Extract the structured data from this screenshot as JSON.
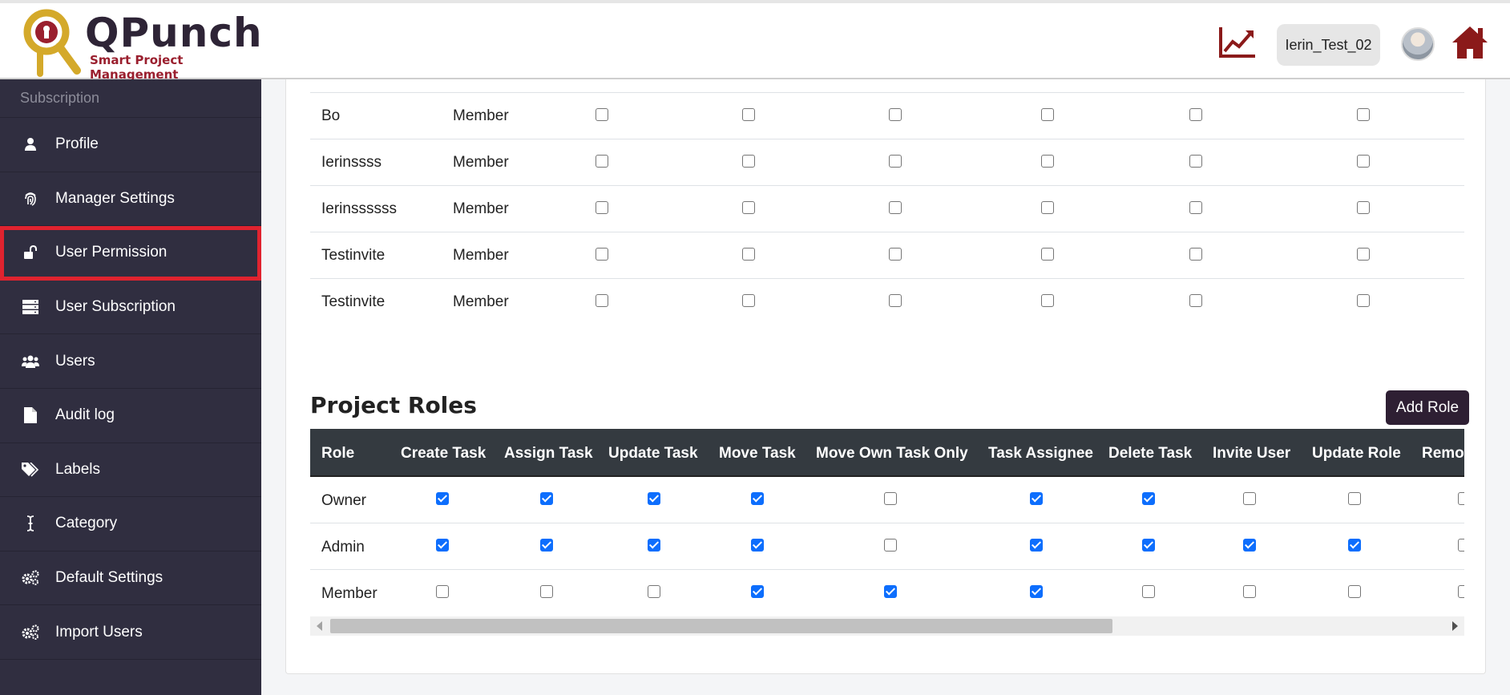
{
  "header": {
    "logo_title": "QPunch",
    "logo_subtitle": "Smart Project Management",
    "user_name": "Ierin_Test_02"
  },
  "sidebar": {
    "heading": "Subscription",
    "items": [
      {
        "label": "Profile",
        "icon": "user-icon"
      },
      {
        "label": "Manager Settings",
        "icon": "fingerprint-icon"
      },
      {
        "label": "User Permission",
        "icon": "unlock-icon",
        "active": true
      },
      {
        "label": "User Subscription",
        "icon": "server-icon"
      },
      {
        "label": "Users",
        "icon": "users-icon"
      },
      {
        "label": "Audit log",
        "icon": "file-icon"
      },
      {
        "label": "Labels",
        "icon": "tags-icon"
      },
      {
        "label": "Category",
        "icon": "text-cursor-icon"
      },
      {
        "label": "Default Settings",
        "icon": "gears-icon"
      },
      {
        "label": "Import Users",
        "icon": "gears-icon"
      }
    ]
  },
  "members_table": {
    "rows": [
      {
        "name": "Bo",
        "role": "Member",
        "checks": [
          false,
          false,
          false,
          false,
          false,
          false
        ]
      },
      {
        "name": "Ierinssss",
        "role": "Member",
        "checks": [
          false,
          false,
          false,
          false,
          false,
          false
        ]
      },
      {
        "name": "Ierinssssss",
        "role": "Member",
        "checks": [
          false,
          false,
          false,
          false,
          false,
          false
        ]
      },
      {
        "name": "Testinvite",
        "role": "Member",
        "checks": [
          false,
          false,
          false,
          false,
          false,
          false
        ]
      },
      {
        "name": "Testinvite",
        "role": "Member",
        "checks": [
          false,
          false,
          false,
          false,
          false,
          false
        ]
      }
    ]
  },
  "project_roles": {
    "title": "Project Roles",
    "add_button": "Add Role",
    "columns": [
      "Role",
      "Create Task",
      "Assign Task",
      "Update Task",
      "Move Task",
      "Move Own Task Only",
      "Task Assignee",
      "Delete Task",
      "Invite User",
      "Update Role",
      "Remo"
    ],
    "rows": [
      {
        "role": "Owner",
        "checks": [
          true,
          true,
          true,
          true,
          false,
          true,
          true,
          false,
          false,
          false
        ]
      },
      {
        "role": "Admin",
        "checks": [
          true,
          true,
          true,
          true,
          false,
          true,
          true,
          true,
          true,
          false
        ]
      },
      {
        "role": "Member",
        "checks": [
          false,
          false,
          false,
          true,
          true,
          true,
          false,
          false,
          false,
          false
        ]
      }
    ]
  },
  "colors": {
    "sidebar_bg": "#302e40",
    "active_outline": "#e0232f",
    "checkbox_checked": "#0d6efd",
    "table_head_bg": "#343a40",
    "brand_dark_red": "#8b1a1a"
  }
}
